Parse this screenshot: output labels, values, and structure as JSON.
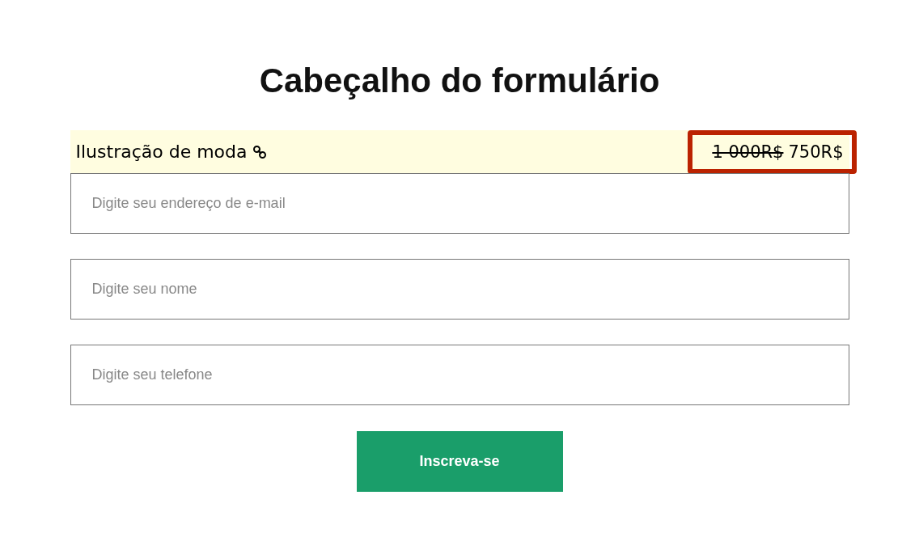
{
  "heading": "Cabeçalho do formulário",
  "product": {
    "name": "Ilustração de moda",
    "old_price": "1 000R$",
    "price": "750R$",
    "highlighted": true
  },
  "fields": [
    {
      "placeholder": "Digite seu endereço de e-mail"
    },
    {
      "placeholder": "Digite seu nome"
    },
    {
      "placeholder": "Digite seu telefone"
    }
  ],
  "button": "Inscreva-se"
}
